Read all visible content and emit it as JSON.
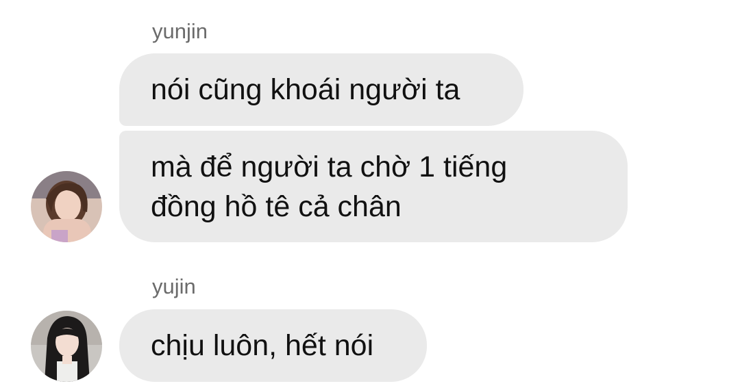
{
  "thread": {
    "groups": [
      {
        "sender": "yunjin",
        "avatar_icon": "user-avatar-photo",
        "messages": [
          "nói cũng khoái người ta",
          "mà để người ta chờ 1 tiếng\nđồng hồ tê cả chân"
        ]
      },
      {
        "sender": "yujin",
        "avatar_icon": "user-avatar-photo",
        "messages": [
          "chịu luôn, hết nói"
        ]
      }
    ]
  },
  "colors": {
    "bubble_bg": "#eaeaea",
    "sender_text": "#6b6b6b",
    "message_text": "#111111",
    "page_bg": "#ffffff"
  }
}
